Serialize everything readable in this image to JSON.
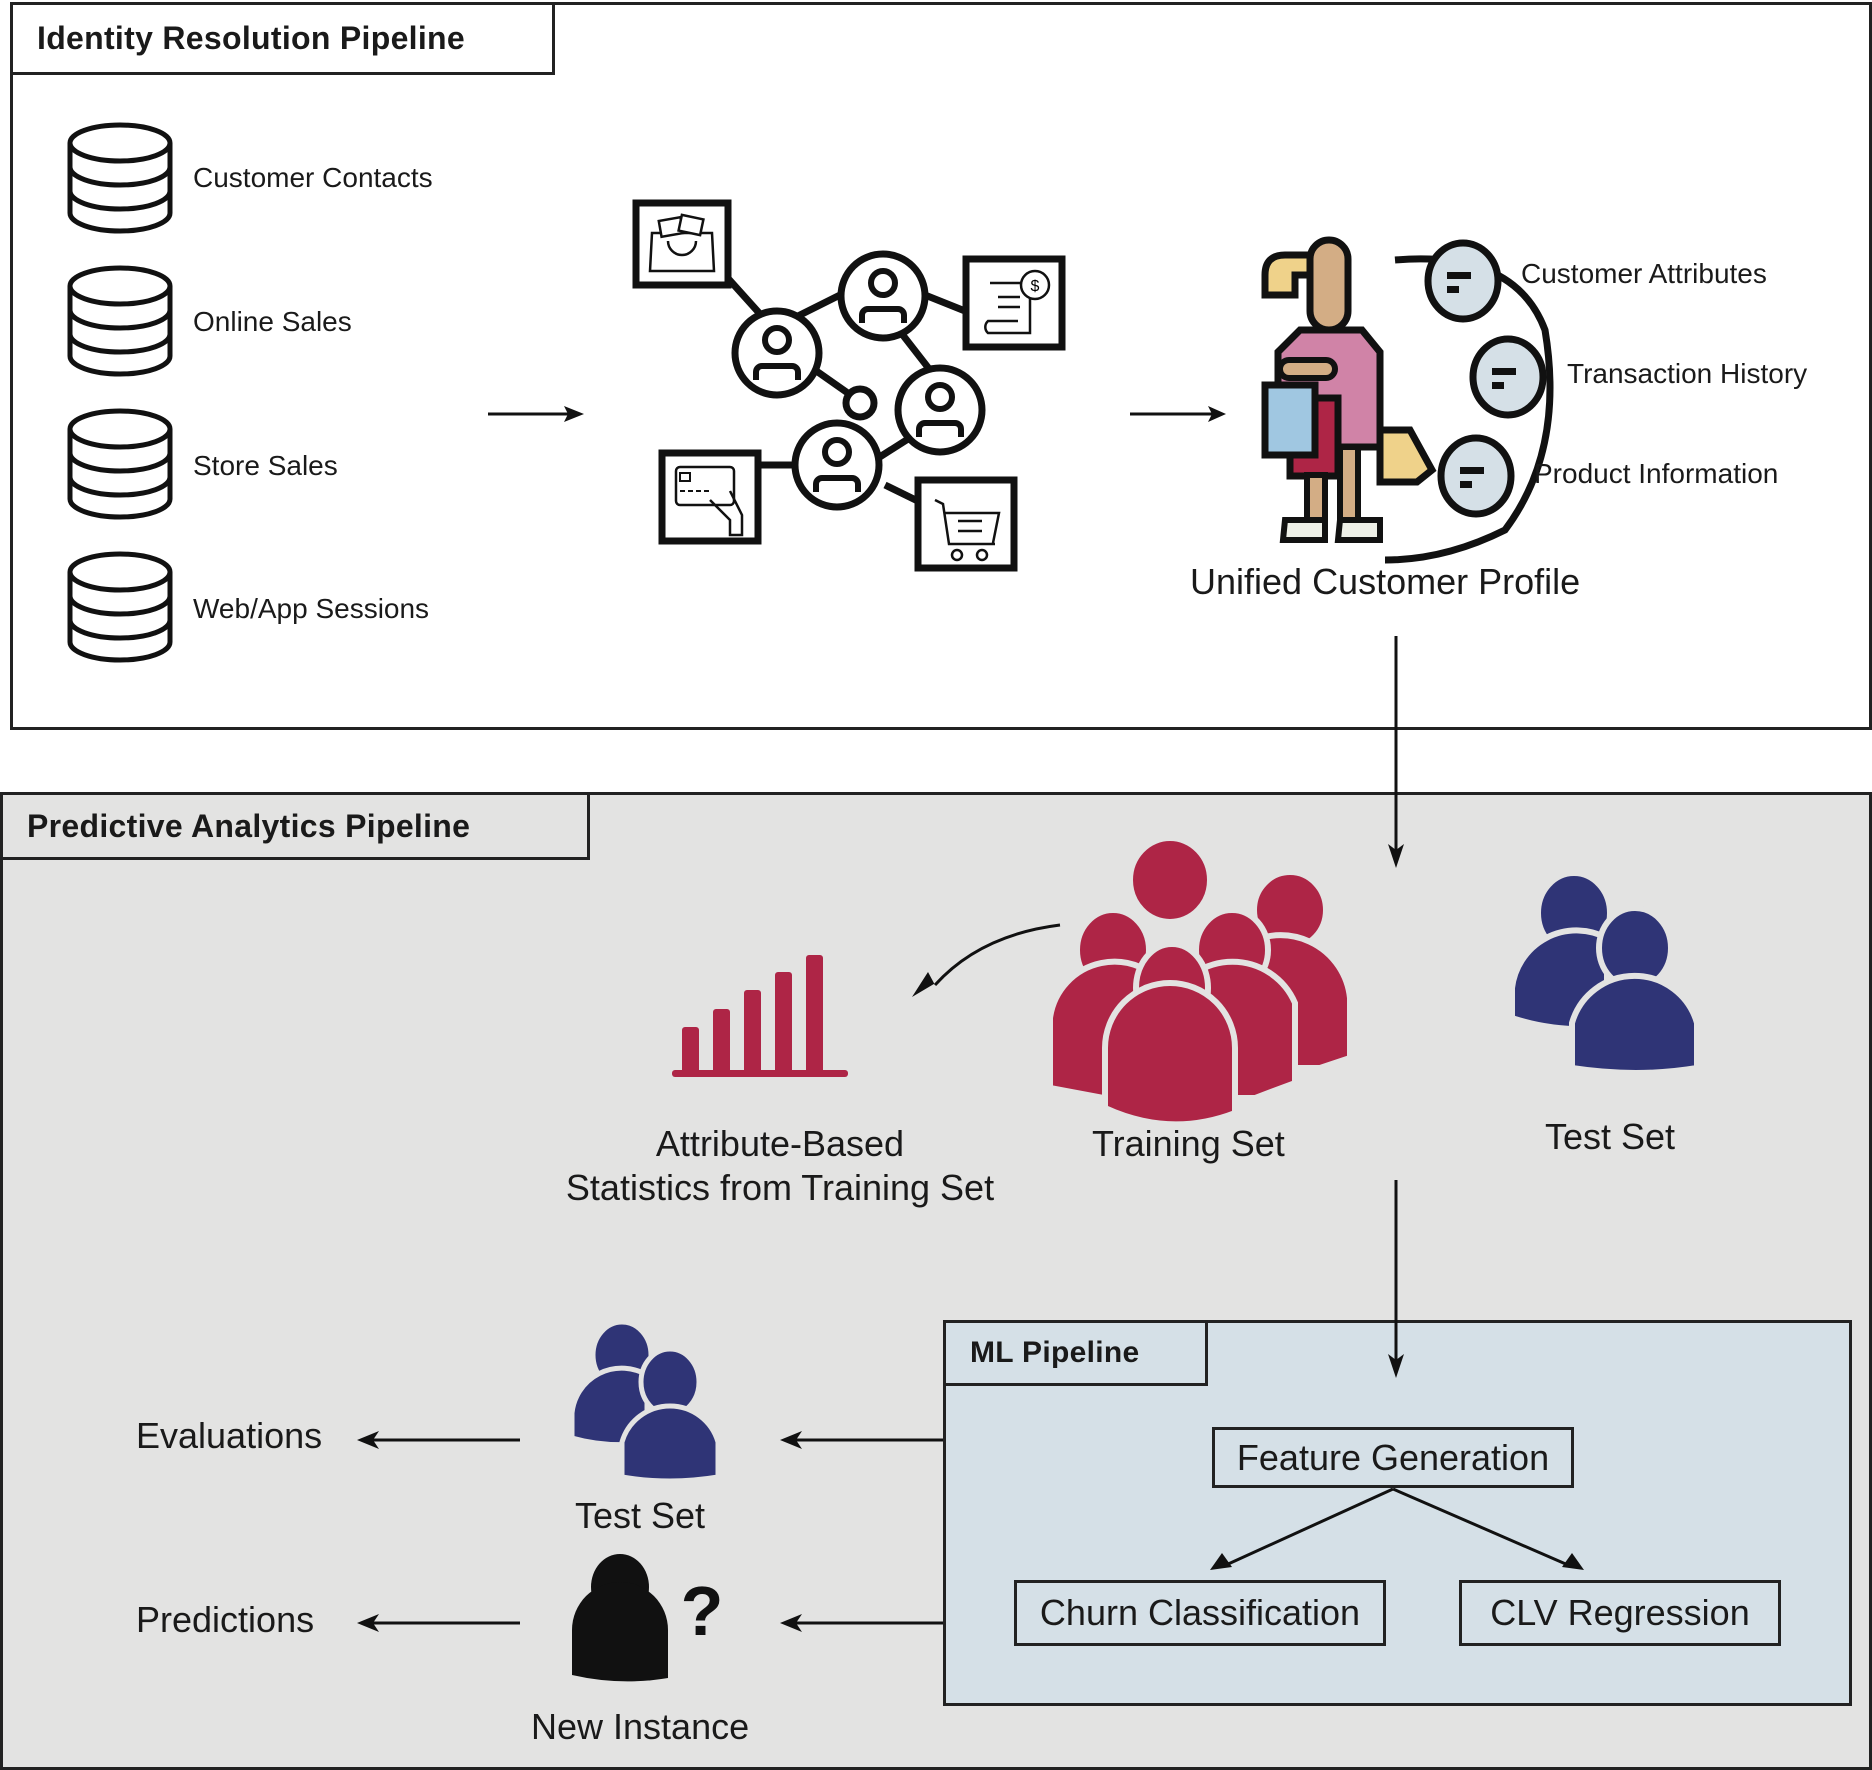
{
  "identity_panel": {
    "title": "Identity Resolution Pipeline",
    "sources": [
      {
        "label": "Customer Contacts",
        "icon": "database-icon"
      },
      {
        "label": "Online Sales",
        "icon": "database-icon"
      },
      {
        "label": "Store Sales",
        "icon": "database-icon"
      },
      {
        "label": "Web/App Sessions",
        "icon": "database-icon"
      }
    ],
    "network_icons": [
      "shopping-bag-icon",
      "receipt-dollar-icon",
      "credit-card-hand-icon",
      "shopping-cart-icon",
      "user-node-icon"
    ],
    "profile": {
      "label": "Unified Customer Profile",
      "attributes": [
        "Customer Attributes",
        "Transaction History",
        "Product Information"
      ]
    }
  },
  "predictive_panel": {
    "title": "Predictive Analytics Pipeline",
    "stats_label_line1": "Attribute-Based",
    "stats_label_line2": "Statistics from Training Set",
    "training_label": "Training Set",
    "test_label": "Test Set",
    "test_label_bottom": "Test Set",
    "new_instance_label": "New Instance",
    "evaluations_label": "Evaluations",
    "predictions_label": "Predictions",
    "question_mark": "?"
  },
  "ml_panel": {
    "title": "ML Pipeline",
    "feature_generation": "Feature Generation",
    "churn": "Churn Classification",
    "clv": "CLV Regression"
  },
  "colors": {
    "training": "#ae2546",
    "test": "#2f3476",
    "panel_gray": "#e3e3e2",
    "ml_blue": "#d5e0e7",
    "attr_circle": "#d5e0e7"
  }
}
